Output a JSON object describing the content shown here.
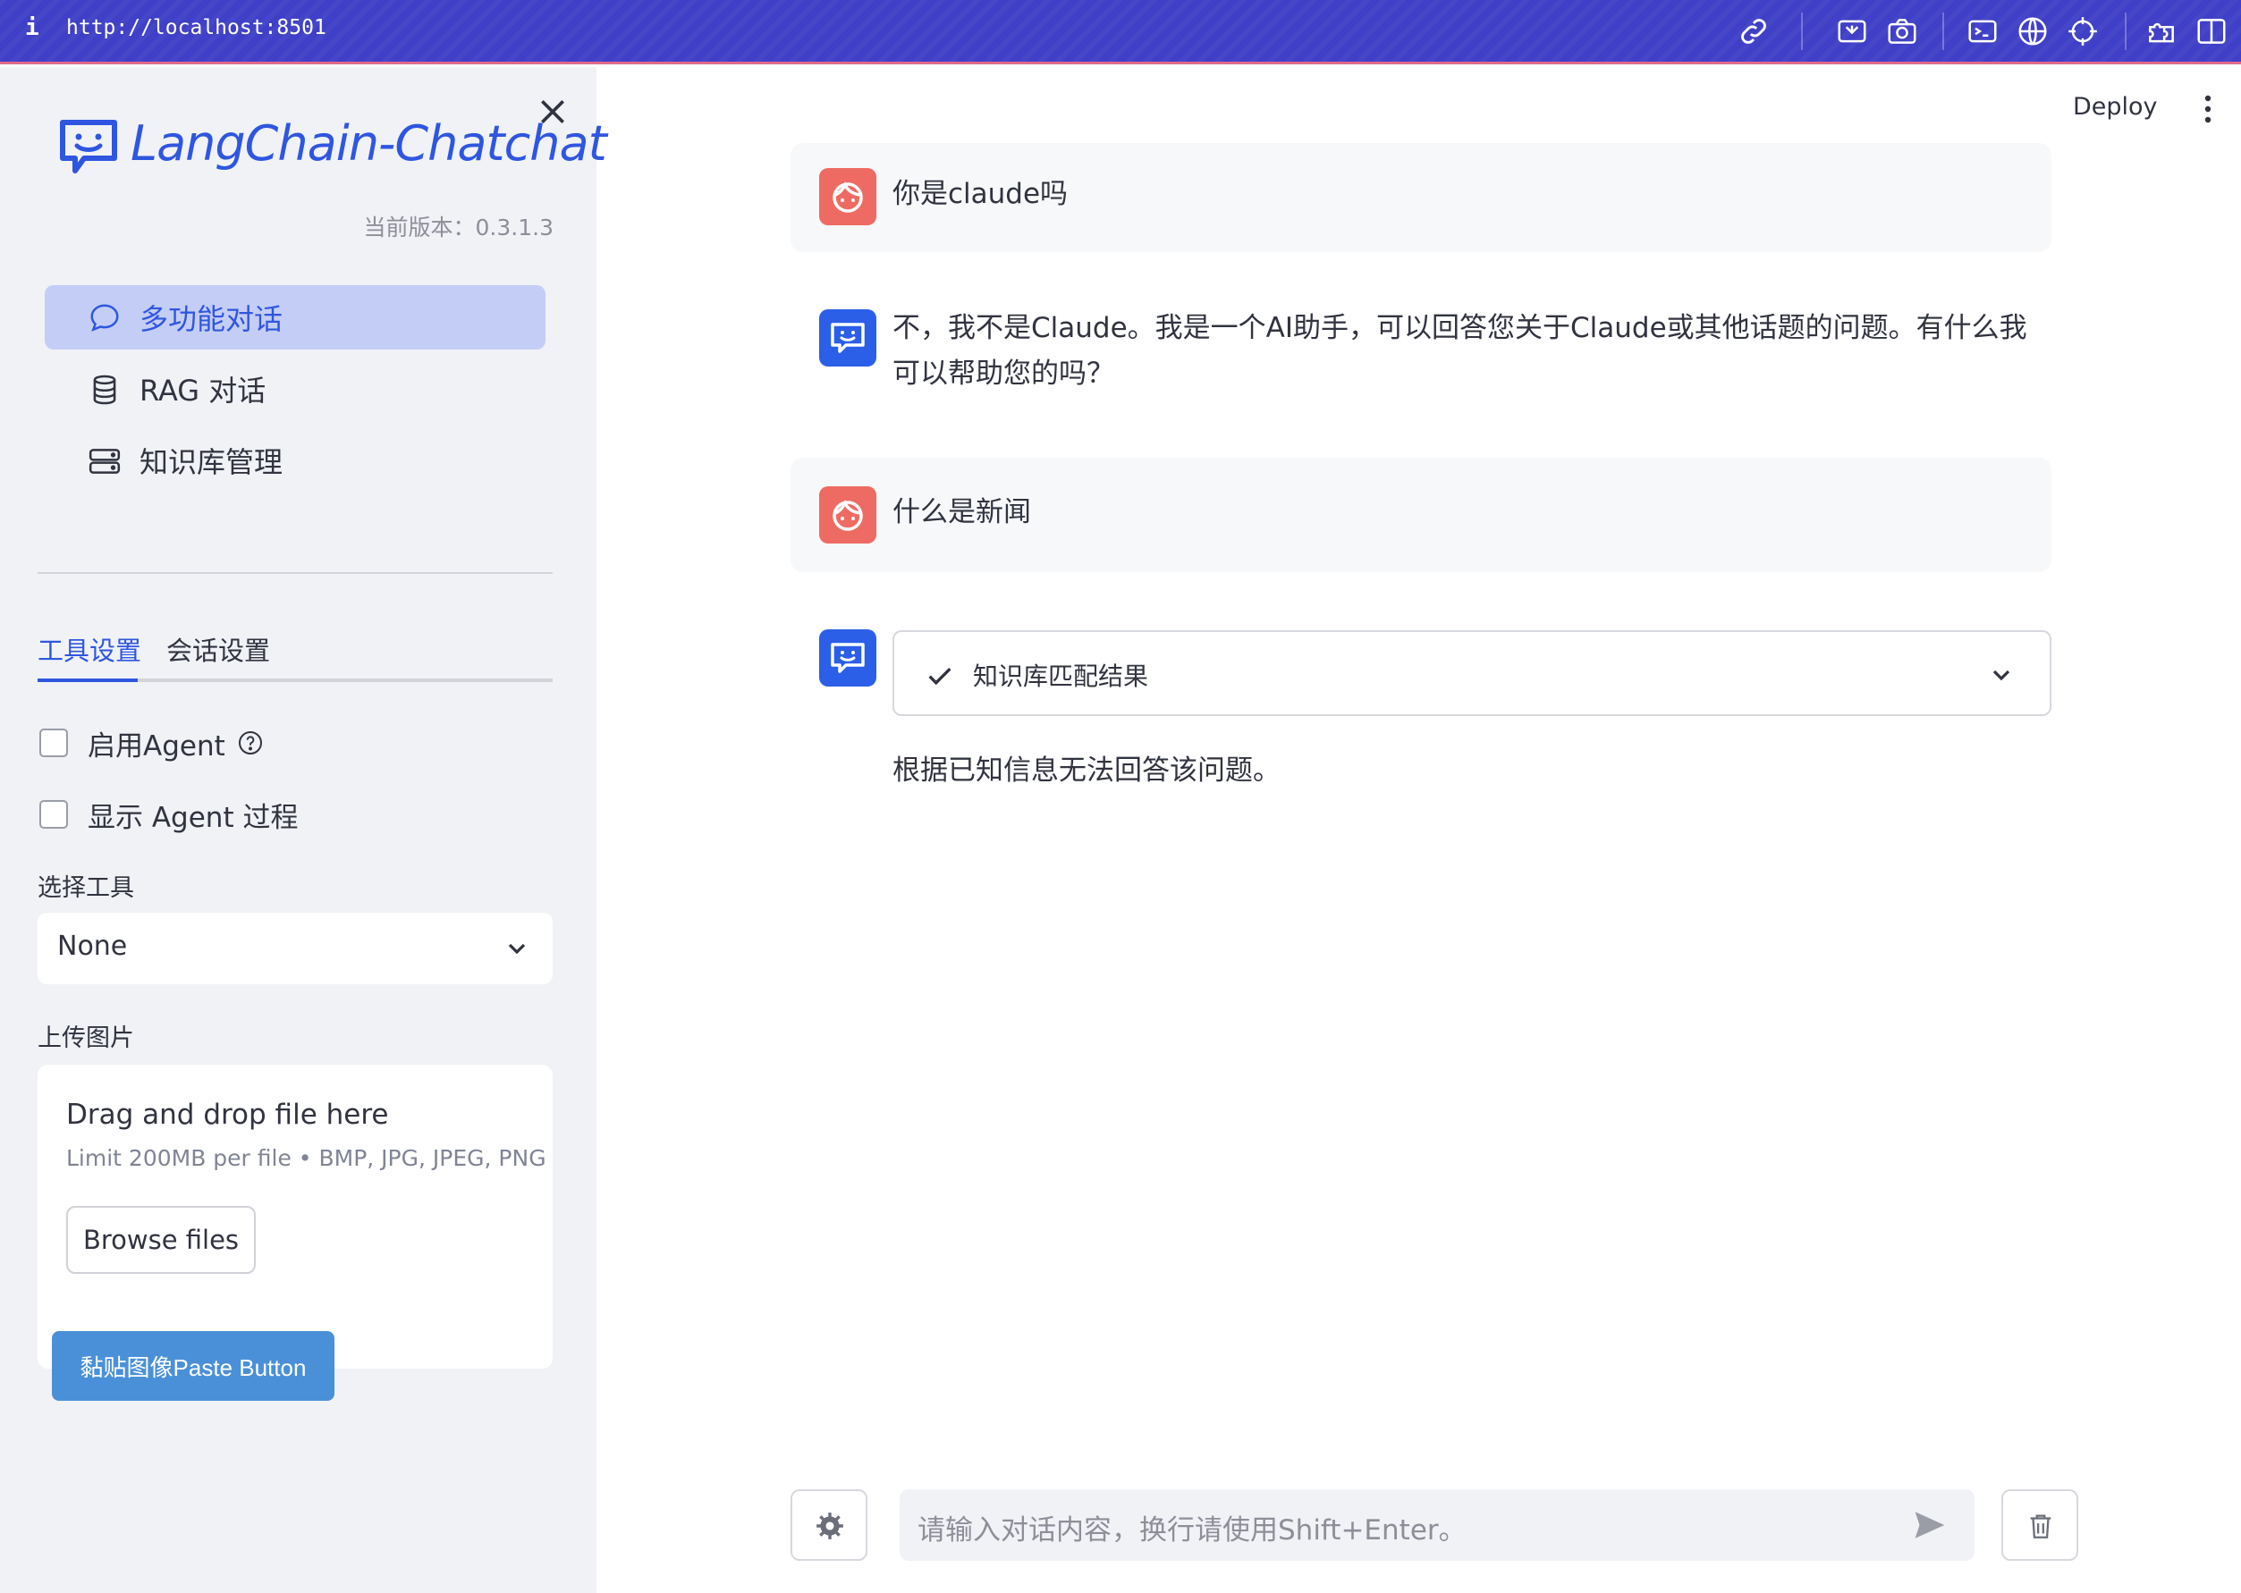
{
  "browser": {
    "info_glyph": "i",
    "url": "http://localhost:8501",
    "icons": [
      "link-icon",
      "screencast-icon",
      "camera-icon",
      "terminal-icon",
      "globe-icon",
      "crosshair-icon",
      "extensions-icon",
      "sidebar-toggle-icon"
    ]
  },
  "sidebar": {
    "logo_text": "LangChain-Chatchat",
    "version": "当前版本：0.3.1.3",
    "nav": [
      {
        "label": "多功能对话",
        "icon": "chat-bubble-icon",
        "active": true
      },
      {
        "label": "RAG 对话",
        "icon": "database-icon",
        "active": false
      },
      {
        "label": "知识库管理",
        "icon": "hdd-stack-icon",
        "active": false
      }
    ],
    "tabs": [
      {
        "label": "工具设置",
        "active": true
      },
      {
        "label": "会话设置",
        "active": false
      }
    ],
    "checkboxes": [
      {
        "label": "启用Agent",
        "checked": false,
        "has_help": true
      },
      {
        "label": "显示 Agent 过程",
        "checked": false,
        "has_help": false
      }
    ],
    "tool_select": {
      "label": "选择工具",
      "value": "None"
    },
    "upload": {
      "label": "上传图片",
      "title": "Drag and drop file here",
      "limit": "Limit 200MB per file • BMP, JPG, JPEG, PNG",
      "browse_label": "Browse files"
    },
    "paste_button": "黏贴图像Paste Button"
  },
  "header": {
    "deploy_label": "Deploy"
  },
  "chat": {
    "messages": [
      {
        "role": "user",
        "text": "你是claude吗"
      },
      {
        "role": "assistant",
        "text_line1": "不，我不是Claude。我是一个AI助手，可以回答您关于Claude或其他话题的问题。有什么我",
        "text_line2": "可以帮助您的吗？"
      },
      {
        "role": "user",
        "text": "什么是新闻"
      },
      {
        "role": "assistant",
        "expander_label": "知识库匹配结果",
        "expander_status": "complete",
        "text": "根据已知信息无法回答该问题。"
      }
    ],
    "input_placeholder": "请输入对话内容，换行请使用Shift+Enter。"
  },
  "colors": {
    "browser_bar": "#3f3fc7",
    "sidebar_bg": "#f0f2f6",
    "accent": "#2f56e0",
    "active_nav_bg": "#c4cdf6",
    "user_avatar": "#ee6b63",
    "bot_avatar": "#2c5fe8",
    "paste_button": "#4a90d9"
  }
}
